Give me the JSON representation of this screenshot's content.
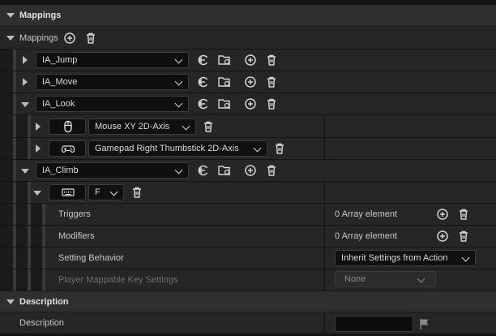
{
  "sections": {
    "mappings_title": "Mappings",
    "description_title": "Description"
  },
  "mappings_array": {
    "label": "Mappings",
    "actions": [
      {
        "name": "IA_Jump",
        "expanded": false
      },
      {
        "name": "IA_Move",
        "expanded": false
      },
      {
        "name": "IA_Look",
        "expanded": true,
        "keys": [
          {
            "key": "Mouse XY 2D-Axis",
            "icon": "mouse-icon"
          },
          {
            "key": "Gamepad Right Thumbstick 2D-Axis",
            "icon": "gamepad-icon"
          }
        ]
      },
      {
        "name": "IA_Climb",
        "expanded": true,
        "keys": [
          {
            "key": "F",
            "icon": "keyboard-icon"
          }
        ]
      }
    ]
  },
  "key_details": {
    "triggers_label": "Triggers",
    "triggers_value": "0 Array element",
    "modifiers_label": "Modifiers",
    "modifiers_value": "0 Array element",
    "setting_behavior_label": "Setting Behavior",
    "setting_behavior_value": "Inherit Settings from Action",
    "player_mappable_label": "Player Mappable Key Settings",
    "player_mappable_value": "None"
  },
  "description": {
    "label": "Description",
    "value": ""
  },
  "icons": [
    "chevron-down-icon",
    "add-icon",
    "trash-icon",
    "use-selected-icon",
    "browse-icon",
    "expand-arrow-icon",
    "flag-icon"
  ]
}
